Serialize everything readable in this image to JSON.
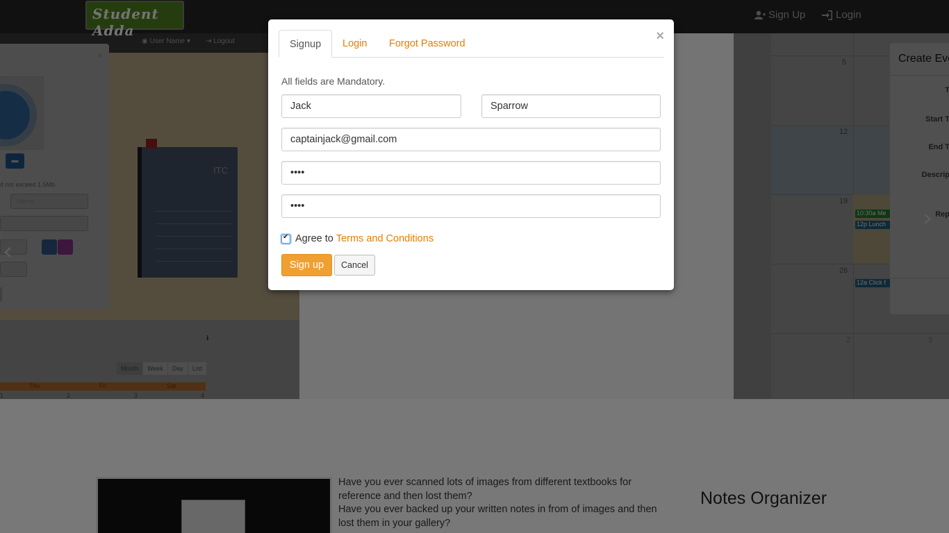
{
  "navbar": {
    "logo_text": "Student Adda",
    "signup_label": "Sign Up",
    "login_label": "Login"
  },
  "background": {
    "user_menu": "User Name",
    "logout": "Logout",
    "size_note": "d not exceed 1.5Mb.",
    "name_placeholder": "Name",
    "notebook_label": "ITC",
    "calendar_views": [
      "Month",
      "Week",
      "Day",
      "List"
    ],
    "calendar_days": [
      "Thu",
      "Fri",
      "Sat"
    ],
    "calendar_week_nums": [
      "1",
      "2",
      "3",
      "4"
    ],
    "calendar_dates": [
      "5",
      "12",
      "19",
      "26",
      "2",
      "3"
    ],
    "calendar_events": [
      "10:30a Me",
      "12p Lunch",
      "12a Click f"
    ],
    "event_card_title": "Create Eve",
    "event_card_labels": [
      "T",
      "Start T",
      "End T",
      "Descrip",
      "Rep"
    ]
  },
  "bottom": {
    "description_lines": [
      "Have you ever scanned lots of images from different textbooks for reference and then lost them?",
      "Have you ever backed up your written notes in from of images and then lost them in your gallery?"
    ],
    "notes_title": "Notes Organizer"
  },
  "modal": {
    "close_symbol": "×",
    "tabs": [
      "Signup",
      "Login",
      "Forgot Password"
    ],
    "mandatory_text": "All fields are Mandatory.",
    "first_name": "Jack",
    "last_name": "Sparrow",
    "email": "captainjack@gmail.com",
    "password": "••••",
    "confirm_password": "••••",
    "agree_text": "Agree to",
    "terms_link": "Terms and Conditions",
    "agree_checked": true,
    "signup_button": "Sign up",
    "cancel_button": "Cancel"
  },
  "colors": {
    "accent": "#e67e00",
    "signup_button": "#f0a030"
  }
}
